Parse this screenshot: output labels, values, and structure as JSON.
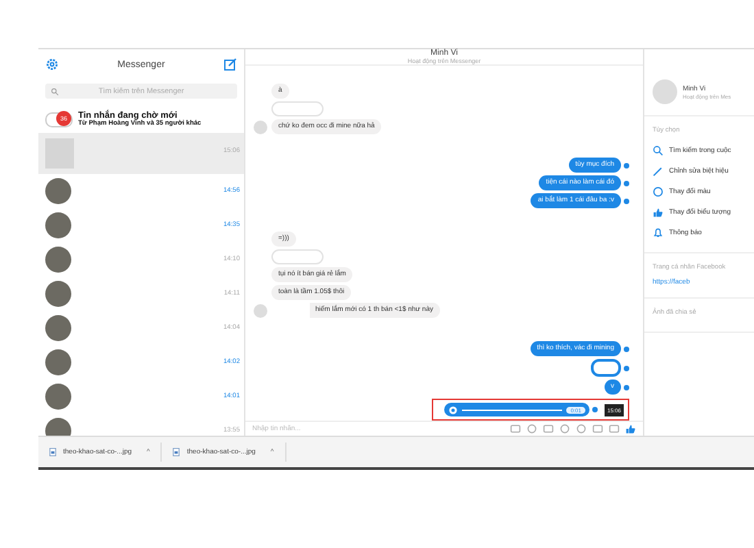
{
  "sidebar": {
    "title": "Messenger",
    "search": {
      "placeholder": "Tìm kiếm trên Messenger"
    },
    "pending": {
      "count": "36",
      "title": "Tin nhắn đang chờ mới",
      "subtitle": "Từ Phạm Hoàng Vinh và 35 người khác"
    },
    "conversations": [
      {
        "time": "15:06",
        "unread": false,
        "selected": true
      },
      {
        "time": "14:56",
        "unread": true,
        "selected": false
      },
      {
        "time": "14:35",
        "unread": true,
        "selected": false
      },
      {
        "time": "14:10",
        "unread": false,
        "selected": false
      },
      {
        "time": "14:11",
        "unread": false,
        "selected": false
      },
      {
        "time": "14:04",
        "unread": false,
        "selected": false
      },
      {
        "time": "14:02",
        "unread": true,
        "selected": false
      },
      {
        "time": "14:01",
        "unread": true,
        "selected": false
      },
      {
        "time": "13:55",
        "unread": false,
        "selected": false
      }
    ]
  },
  "chat": {
    "name": "Minh Vi",
    "status": "Hoạt động trên Messenger",
    "groups": [
      {
        "outgoing": false,
        "messages": [
          {
            "kind": "text",
            "text": "à"
          },
          {
            "kind": "redacted"
          },
          {
            "kind": "text",
            "text": "chứ ko đem occ đi mine nữa hả"
          }
        ]
      },
      {
        "outgoing": true,
        "messages": [
          {
            "kind": "text",
            "text": "tùy mục đích"
          },
          {
            "kind": "text",
            "text": "tiện cái nào làm cái đó"
          },
          {
            "kind": "text",
            "text": "ai bắt làm 1 cái đâu ba :v"
          }
        ]
      },
      {
        "outgoing": false,
        "messages": [
          {
            "kind": "text",
            "text": "=)))"
          },
          {
            "kind": "redacted"
          },
          {
            "kind": "text",
            "text": "tụi nó ít bán giá rẻ lắm"
          },
          {
            "kind": "text",
            "text": "toàn là tầm 1.05$ thôi"
          },
          {
            "kind": "partly-redacted",
            "text": "hiếm lắm mới có 1 th bán <1$ như này"
          }
        ]
      },
      {
        "outgoing": true,
        "messages": [
          {
            "kind": "text",
            "text": "thì ko thích, vác đi mining"
          },
          {
            "kind": "redacted"
          },
          {
            "kind": "text",
            "text": "v"
          },
          {
            "kind": "audio",
            "duration": "0:01",
            "tooltip": "15:06",
            "highlighted": true
          }
        ]
      }
    ],
    "composer": {
      "placeholder": "Nhập tin nhắn..."
    }
  },
  "details": {
    "name": "Minh Vi",
    "status": "Hoạt động trên Mes",
    "options_heading": "Tùy chọn",
    "options": [
      {
        "kind": "search",
        "label": "Tìm kiếm trong cuộc"
      },
      {
        "kind": "edit",
        "label": "Chỉnh sửa biệt hiệu"
      },
      {
        "kind": "color",
        "label": "Thay đổi màu"
      },
      {
        "kind": "like",
        "label": "Thay đổi biểu tượng"
      },
      {
        "kind": "bell",
        "label": "Thông báo"
      }
    ],
    "profile_heading": "Trang cá nhân Facebook",
    "profile_link": "https://faceb",
    "photos_heading": "Ảnh đã chia sẻ"
  },
  "downloads": [
    {
      "name": "theo-khao-sat-co-...jpg",
      "caret": "^"
    },
    {
      "name": "theo-khao-sat-co-...jpg",
      "caret": "^"
    }
  ]
}
